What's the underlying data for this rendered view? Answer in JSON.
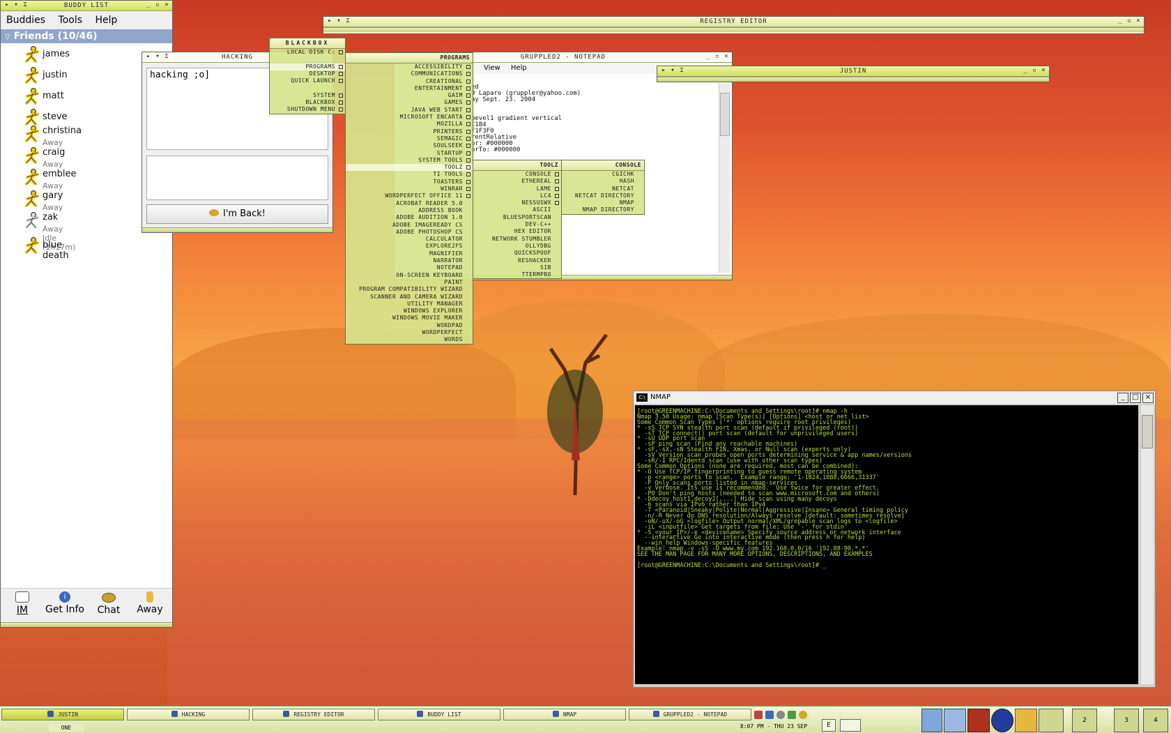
{
  "buddy_list": {
    "title": "BUDDY LIST",
    "menu": [
      "Buddies",
      "Tools",
      "Help"
    ],
    "group": "Friends (10/46)",
    "buddies": [
      {
        "name": "james",
        "status": ""
      },
      {
        "name": "justin",
        "status": ""
      },
      {
        "name": "matt",
        "status": ""
      },
      {
        "name": "steve",
        "status": ""
      },
      {
        "name": "christina",
        "status": "Away"
      },
      {
        "name": "craig",
        "status": "Away"
      },
      {
        "name": "emblee",
        "status": "Away"
      },
      {
        "name": "gary",
        "status": "Away"
      },
      {
        "name": "zak",
        "status": "Away Idle (1h17m)"
      },
      {
        "name": "blue death",
        "status": ""
      }
    ],
    "actions": [
      "IM",
      "Get Info",
      "Chat",
      "Away"
    ]
  },
  "hacking": {
    "title": "HACKING",
    "message": "hacking  ;o]",
    "back_button": "I'm Back!"
  },
  "registry_editor": {
    "title": "REGISTRY EDITOR"
  },
  "notepad": {
    "title": "GRUPPLED2 - NOTEPAD",
    "menu": [
      "View",
      "Help"
    ],
    "lines": [
      "ed",
      "9 Laparo (gruppler@yahoo.com)",
      "ay Sept. 23. 2004",
      "",
      "",
      "bevel1 gradient vertical",
      "C1B4",
      "F1F3F0",
      "rentRelative",
      "or: #000000",
      "orTo: #000000"
    ]
  },
  "justin_window": {
    "title": "JUSTIN"
  },
  "blackbox_menu": {
    "title": "BLACKBOX",
    "items": [
      "LOCAL DISK C:",
      "",
      "PROGRAMS",
      "DESKTOP",
      "QUICK LAUNCH",
      "",
      "SYSTEM",
      "BLACKBOX",
      "SHUTDOWN MENU"
    ]
  },
  "programs_menu": {
    "title": "PROGRAMS",
    "items": [
      "ACCESSIBILITY",
      "COMMUNICATIONS",
      "CREATIONAL",
      "ENTERTAINMENT",
      "GAIM",
      "GAMES",
      "JAVA WEB START",
      "MICROSOFT ENCARTA",
      "MOZILLA",
      "PRINTERS",
      "SEMAGIC",
      "SOULSEEK",
      "STARTUP",
      "SYSTEM TOOLS",
      "TOOLZ",
      "TI TOOLS",
      "TOASTERS",
      "WINRAR",
      "WORDPERFECT OFFICE 11",
      "ACROBAT READER 5.0",
      "ADDRESS BOOK",
      "ADOBE AUDITION 1.0",
      "ADOBE IMAGEREADY CS",
      "ADOBE PHOTOSHOP CS",
      "CALCULATOR",
      "EXPLORE2FS",
      "MAGNIFIER",
      "NARRATOR",
      "NOTEPAD",
      "ON-SCREEN KEYBOARD",
      "PAINT",
      "PROGRAM COMPATIBILITY WIZARD",
      "SCANNER AND CAMERA WIZARD",
      "UTILITY MANAGER",
      "WINDOWS EXPLORER",
      "WINDOWS MOVIE MAKER",
      "WORDPAD",
      "WORDPERFECT",
      "WORDS"
    ]
  },
  "toolz_menu": {
    "title": "TOOLZ",
    "items": [
      "CONSOLE",
      "ETHEREAL",
      "LAME",
      "LC4",
      "NESSUSWX",
      "ASCII",
      "BLUESPORTSCAN",
      "DEV-C++",
      "HEX EDITOR",
      "NETWORK STUMBLER",
      "OLLYDBG",
      "QUICKSPOOF",
      "RESHACKER",
      "SIB",
      "TTERMPRO"
    ]
  },
  "console_menu": {
    "title": "CONSOLE",
    "items": [
      "CGICHK",
      "HASH",
      "NETCAT",
      "NETCAT DIRECTORY",
      "NMAP",
      "NMAP DIRECTORY"
    ]
  },
  "nmap": {
    "title": "NMAP",
    "lines": [
      "[root@GREENMACHINE:C:\\Documents and Settings\\root]# nmap -h",
      "Nmap 3.50 Usage: nmap [Scan Type(s)] [Options] <host or net list>",
      "Some Common Scan Types ('*' options require root privileges)",
      "* -sS TCP SYN stealth port scan (default if privileged (root))",
      "  -sT TCP connect() port scan (default for unprivileged users)",
      "* -sU UDP port scan",
      "  -sP ping scan (Find any reachable machines)",
      "* -sF,-sX,-sN Stealth FIN, Xmas, or Null scan (experts only)",
      "  -sV Version scan probes open ports determining service & app names/versions",
      "  -sR/-I RPC/Identd scan (use with other scan types)",
      "Some Common Options (none are required, most can be combined):",
      "* -O Use TCP/IP fingerprinting to guess remote operating system",
      "  -p <range> ports to scan.  Example range: '1-1024,1080,6666,31337'",
      "  -F Only scans ports listed in nmap-services",
      "  -v Verbose. Its use is recommended.  Use twice for greater effect.",
      "  -P0 Don't ping hosts (needed to scan www.microsoft.com and others)",
      "* -Ddecoy_host1,decoy2[,...] Hide scan using many decoys",
      "  -6 scans via IPv6 rather than IPv4",
      "  -T <Paranoid|Sneaky|Polite|Normal|Aggressive|Insane> General timing policy",
      "  -n/-R Never do DNS resolution/Always resolve [default: sometimes resolve]",
      "  -oN/-oX/-oG <logfile> Output normal/XML/grepable scan logs to <logfile>",
      "  -iL <inputfile> Get targets from file; Use '-' for stdin",
      "* -S <your_IP>/-e <devicename> Specify source address or network interface",
      "  --interactive Go into interactive mode (then press h for help)",
      "  --win_help Windows-specific features",
      "Example: nmap -v -sS -O www.my.com 192.168.0.0/16 '192.88-90.*.*'",
      "SEE THE MAN PAGE FOR MANY MORE OPTIONS, DESCRIPTIONS, AND EXAMPLES",
      "",
      "[root@GREENMACHINE:C:\\Documents and Settings\\root]# _"
    ]
  },
  "taskbar": {
    "tasks": [
      "JUSTIN",
      "HACKING",
      "REGISTRY EDITOR",
      "BUDDY LIST",
      "NMAP",
      "GRUPPLED2 - NOTEPAD"
    ],
    "workspace": "ONE",
    "clock": "8:07 PM - THU 23 SEP",
    "pager": [
      "2",
      "3",
      "4"
    ]
  }
}
